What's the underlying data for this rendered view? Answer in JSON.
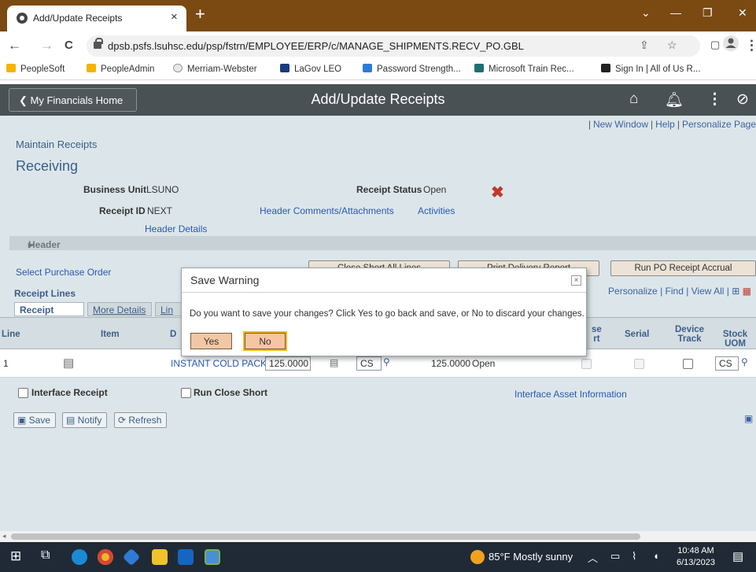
{
  "browser": {
    "tab_title": "Add/Update Receipts",
    "tab_close": "×",
    "new_tab": "+",
    "url": "dpsb.psfs.lsuhsc.edu/psp/fstrn/EMPLOYEE/ERP/c/MANAGE_SHIPMENTS.RECV_PO.GBL",
    "window_controls": {
      "chevron": "⌄",
      "minimize": "—",
      "restore": "❐",
      "close": "✕"
    },
    "nav": {
      "back": "←",
      "forward": "→",
      "reload": "C"
    },
    "bookmarks": [
      {
        "label": "PeopleSoft",
        "color": "#f4b400"
      },
      {
        "label": "PeopleAdmin",
        "color": "#f4b400"
      },
      {
        "label": "Merriam-Webster",
        "color": "#d0d0d0"
      },
      {
        "label": "LaGov LEO",
        "color": "#1a3a7a"
      },
      {
        "label": "Password Strength...",
        "color": "#2e7bd6"
      },
      {
        "label": "Microsoft Train Rec...",
        "color": "#1f6f73"
      },
      {
        "label": "Sign In | All of Us R...",
        "color": "#222222"
      }
    ]
  },
  "banner": {
    "home_button": "My Financials Home",
    "title": "Add/Update Receipts"
  },
  "page": {
    "top_links": [
      "New Window",
      "Help",
      "Personalize Page"
    ],
    "breadcrumb": "Maintain Receipts",
    "title": "Receiving",
    "business_unit_label": "Business Unit",
    "business_unit_value": "LSUNO",
    "receipt_status_label": "Receipt Status",
    "receipt_status_value": "Open",
    "receipt_id_label": "Receipt ID",
    "receipt_id_value": "NEXT",
    "header_comments_link": "Header Comments/Attachments",
    "activities_link": "Activities",
    "header_details_link": "Header Details",
    "header_section": "Header",
    "select_po_link": "Select Purchase Order",
    "buttons": {
      "close_short": "Close Short All Lines",
      "print_delivery": "Print Delivery Report",
      "run_po_accrual": "Run PO Receipt Accrual"
    },
    "receipt_lines_title": "Receipt Lines",
    "grid_actions": "Personalize | Find | View All |",
    "tabs": [
      "Receipt Lines",
      "More Details",
      "Lin"
    ],
    "columns": {
      "line": "Line",
      "item": "Item",
      "d": "D",
      "close_short_1": "se",
      "close_short_2": "rt",
      "serial": "Serial",
      "device_track_1": "Device",
      "device_track_2": "Track",
      "stock_uom": "Stock UOM"
    },
    "row": {
      "line": "1",
      "description": "INSTANT COLD PACK",
      "qty": "125.0000",
      "uom": "CS",
      "accepted": "125.0000",
      "status": "Open",
      "stock_uom": "CS"
    },
    "interface_receipt": "Interface Receipt",
    "run_close_short": "Run Close Short",
    "interface_asset_link": "Interface Asset Information",
    "toolbar": {
      "save": "Save",
      "notify": "Notify",
      "refresh": "Refresh"
    }
  },
  "dialog": {
    "title": "Save Warning",
    "close": "×",
    "message": "Do you want to save your changes? Click Yes to go back and save, or No to discard your changes.",
    "yes": "Yes",
    "no": "No"
  },
  "taskbar": {
    "weather": "85°F  Mostly sunny",
    "time": "10:48 AM",
    "date": "6/13/2023"
  }
}
